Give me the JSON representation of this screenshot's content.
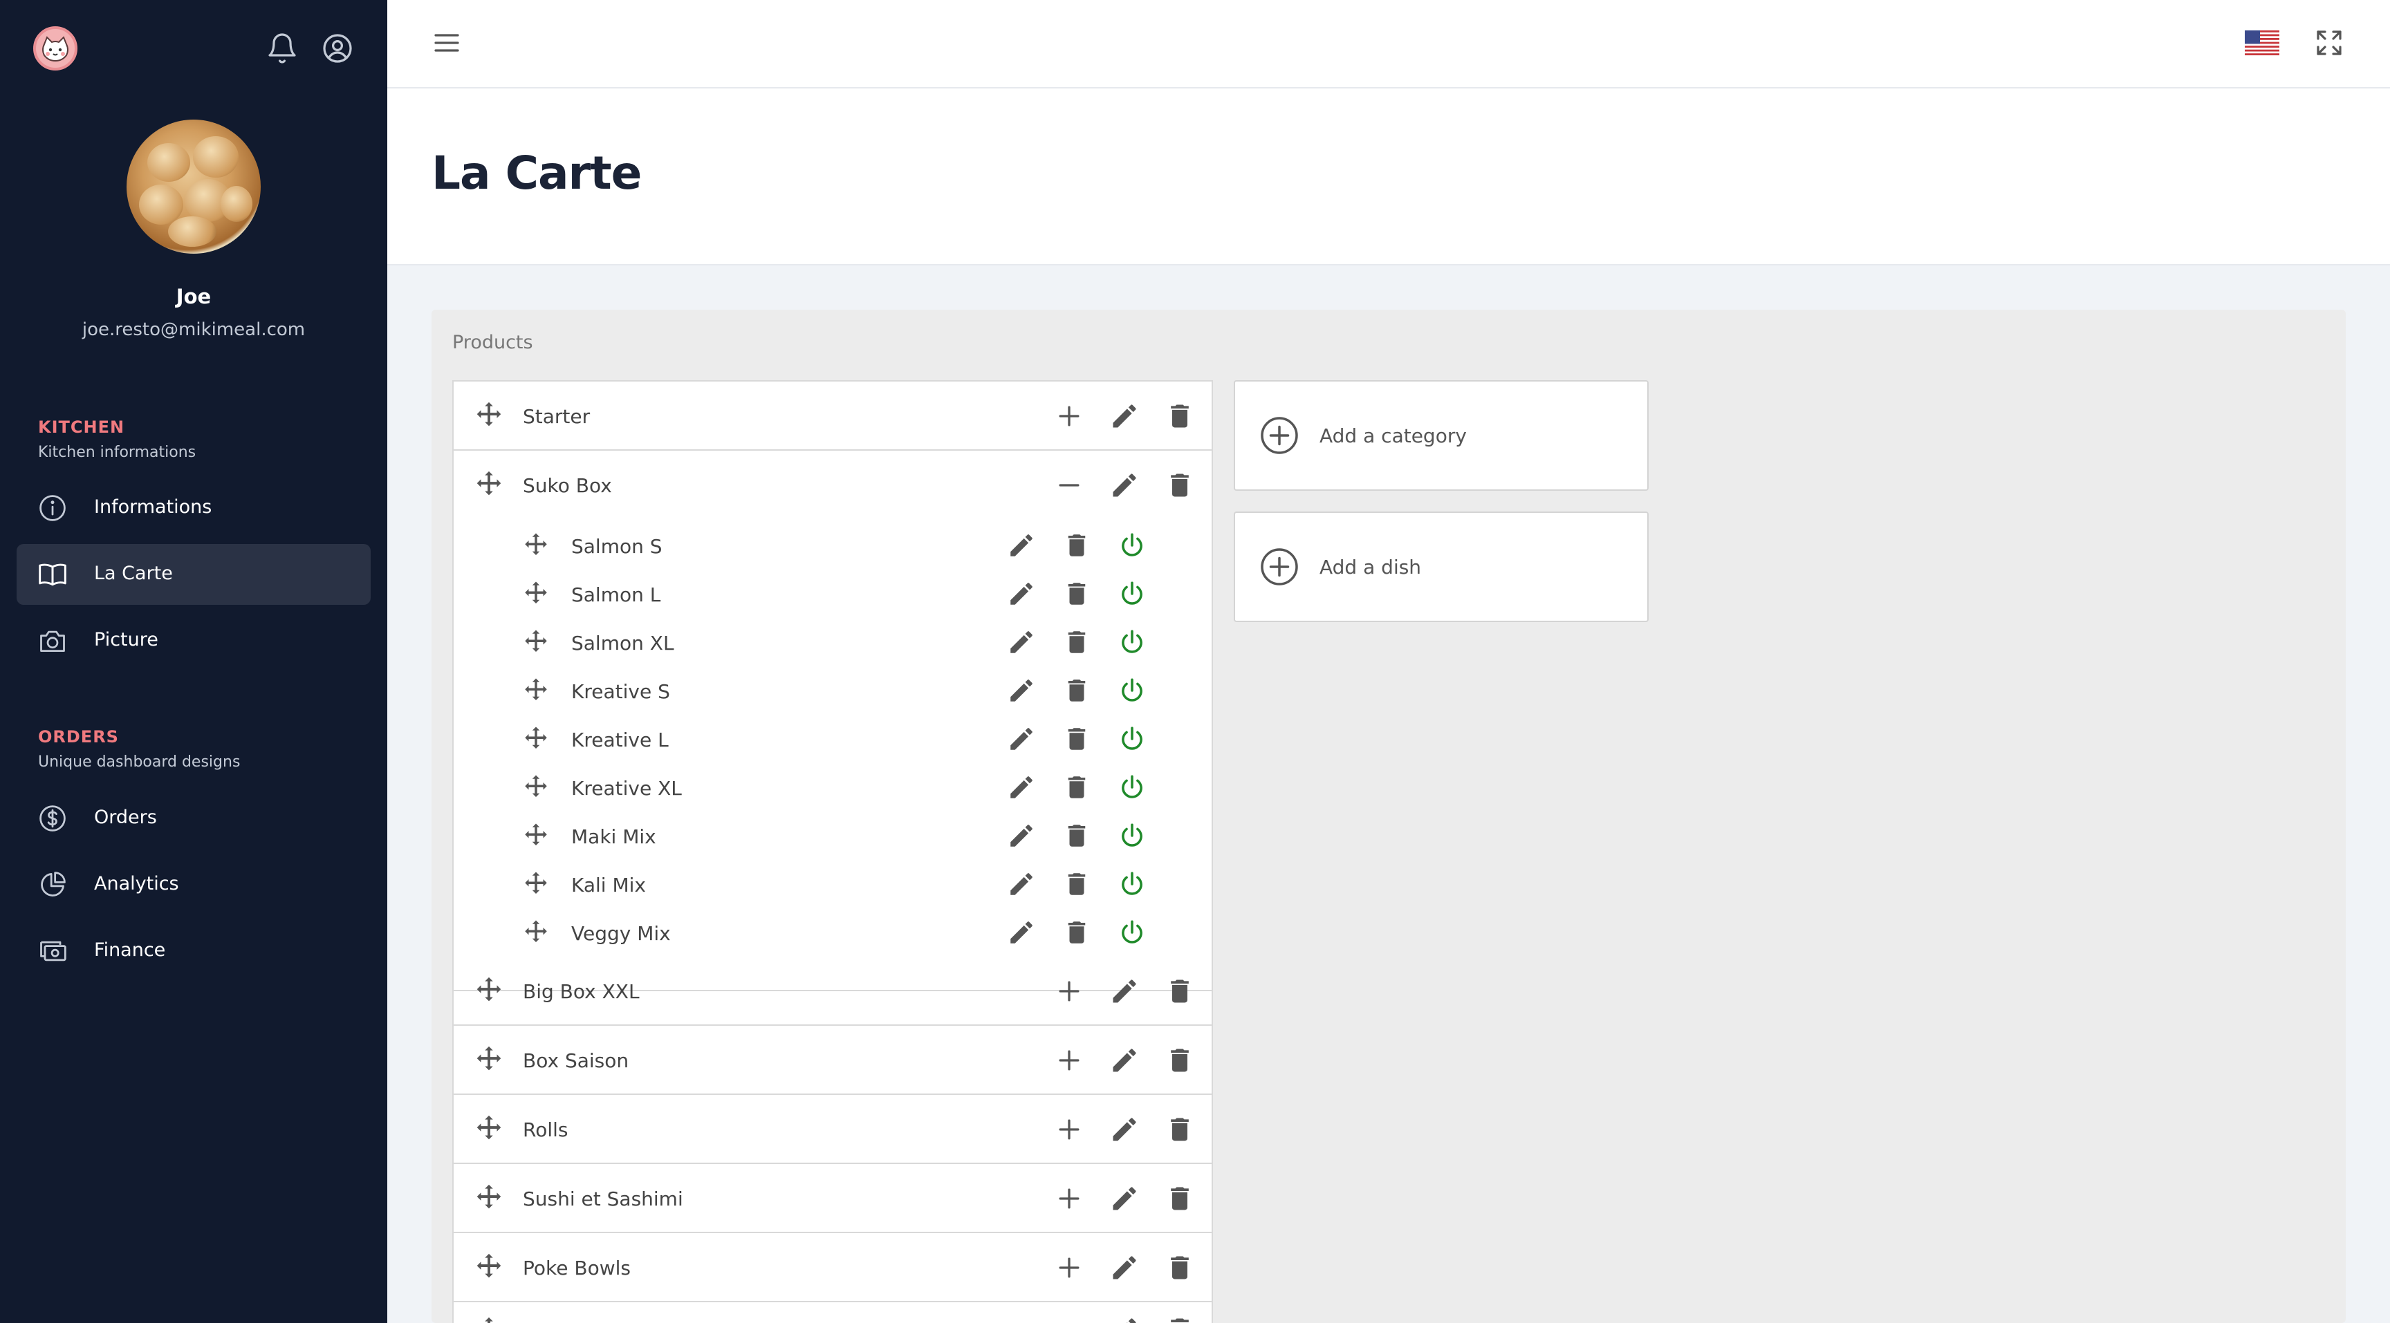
{
  "sidebar": {
    "user": {
      "name": "Joe",
      "email": "joe.resto@mikimeal.com"
    },
    "kitchen": {
      "title": "KITCHEN",
      "subtitle": "Kitchen informations",
      "items": [
        {
          "label": "Informations",
          "icon": "info-icon"
        },
        {
          "label": "La Carte",
          "icon": "book-icon",
          "active": true
        },
        {
          "label": "Picture",
          "icon": "camera-icon"
        }
      ]
    },
    "orders": {
      "title": "ORDERS",
      "subtitle": "Unique dashboard designs",
      "items": [
        {
          "label": "Orders",
          "icon": "dollar-icon"
        },
        {
          "label": "Analytics",
          "icon": "pie-chart-icon"
        },
        {
          "label": "Finance",
          "icon": "cash-icon"
        }
      ]
    }
  },
  "header": {
    "title": "La Carte"
  },
  "panel": {
    "label": "Products",
    "categories": [
      {
        "label": "Starter",
        "expanded": false
      },
      {
        "label": "Suko Box",
        "expanded": true,
        "dishes": [
          "Salmon S",
          "Salmon L",
          "Salmon XL",
          "Kreative S",
          "Kreative L",
          "Kreative XL",
          "Maki Mix",
          "Kali Mix",
          "Veggy Mix"
        ]
      },
      {
        "label": "Big Box XXL",
        "expanded": false
      },
      {
        "label": "Box Saison",
        "expanded": false
      },
      {
        "label": "Rolls",
        "expanded": false
      },
      {
        "label": "Sushi et Sashimi",
        "expanded": false
      },
      {
        "label": "Poke Bowls",
        "expanded": false
      }
    ],
    "add_category_label": "Add a category",
    "add_dish_label": "Add a dish"
  },
  "colors": {
    "sidebar_bg": "#111a2e",
    "accent_red": "#f07a7f",
    "active_green": "#1f8a2a",
    "icon_gray": "#555555"
  }
}
